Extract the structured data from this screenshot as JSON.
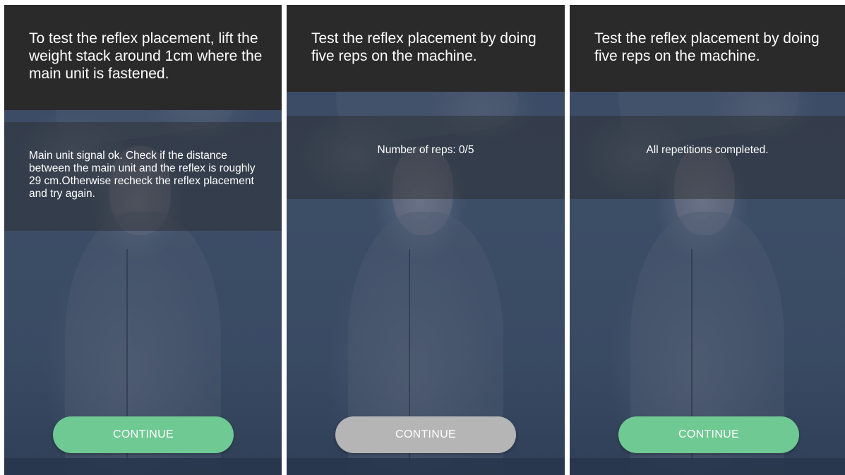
{
  "colors": {
    "header_bg": "#2a2a2a",
    "button_active": "#6fc992",
    "button_disabled": "#b5b5b5",
    "background_tint": "#34465e"
  },
  "screens": [
    {
      "header": "To test the reflex placement, lift the weight stack around 1cm where the main unit is fastened.",
      "message": "Main unit signal ok. Check if the distance between the main unit and the reflex is roughly 29 cm.Otherwise recheck the reflex placement and try again.",
      "button": {
        "label": "CONTINUE",
        "state": "enabled"
      }
    },
    {
      "header": "Test the reflex placement by doing five reps on the machine.",
      "message": "Number of reps: 0/5",
      "button": {
        "label": "CONTINUE",
        "state": "disabled"
      }
    },
    {
      "header": "Test the reflex placement by doing five reps on the machine.",
      "message": "All repetitions completed.",
      "button": {
        "label": "CONTINUE",
        "state": "enabled"
      }
    }
  ]
}
